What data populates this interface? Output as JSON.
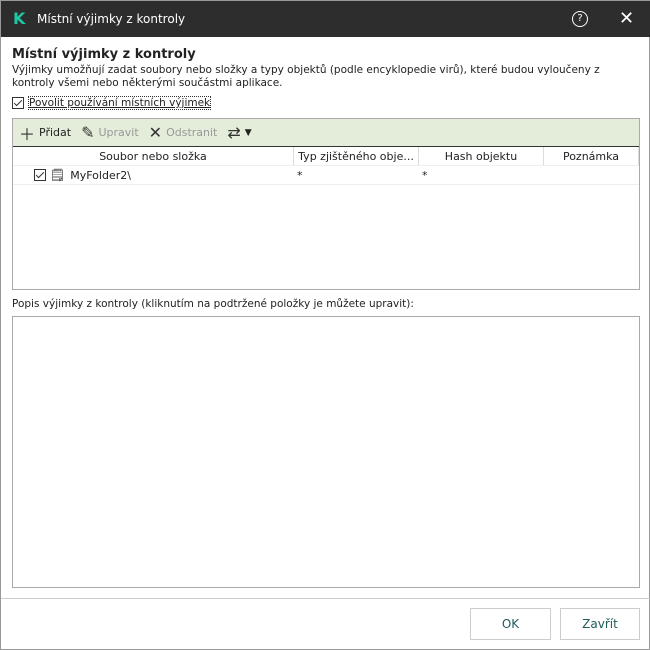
{
  "window": {
    "title": "Místní výjimky z kontroly",
    "logo": "K"
  },
  "heading": "Místní výjimky z kontroly",
  "description": "Výjimky umožňují zadat soubory nebo složky a typy objektů (podle encyklopedie virů), které budou vyloučeny z kontroly všemi nebo některými součástmi aplikace.",
  "enable_checkbox": {
    "label": "Povolit používání místních výjimek",
    "checked": true
  },
  "toolbar": {
    "add": "Přidat",
    "edit": "Upravit",
    "remove": "Odstranit"
  },
  "table": {
    "columns": [
      "Soubor nebo složka",
      "Typ zjištěného obje...",
      "Hash objektu",
      "Poznámka"
    ],
    "rows": [
      {
        "checked": true,
        "file": "MyFolder2\\",
        "type": "*",
        "hash": "*",
        "note": ""
      }
    ]
  },
  "description_label": "Popis výjimky z kontroly (kliknutím na podtržené položky je můžete upravit):",
  "buttons": {
    "ok": "OK",
    "close": "Zavřít"
  }
}
